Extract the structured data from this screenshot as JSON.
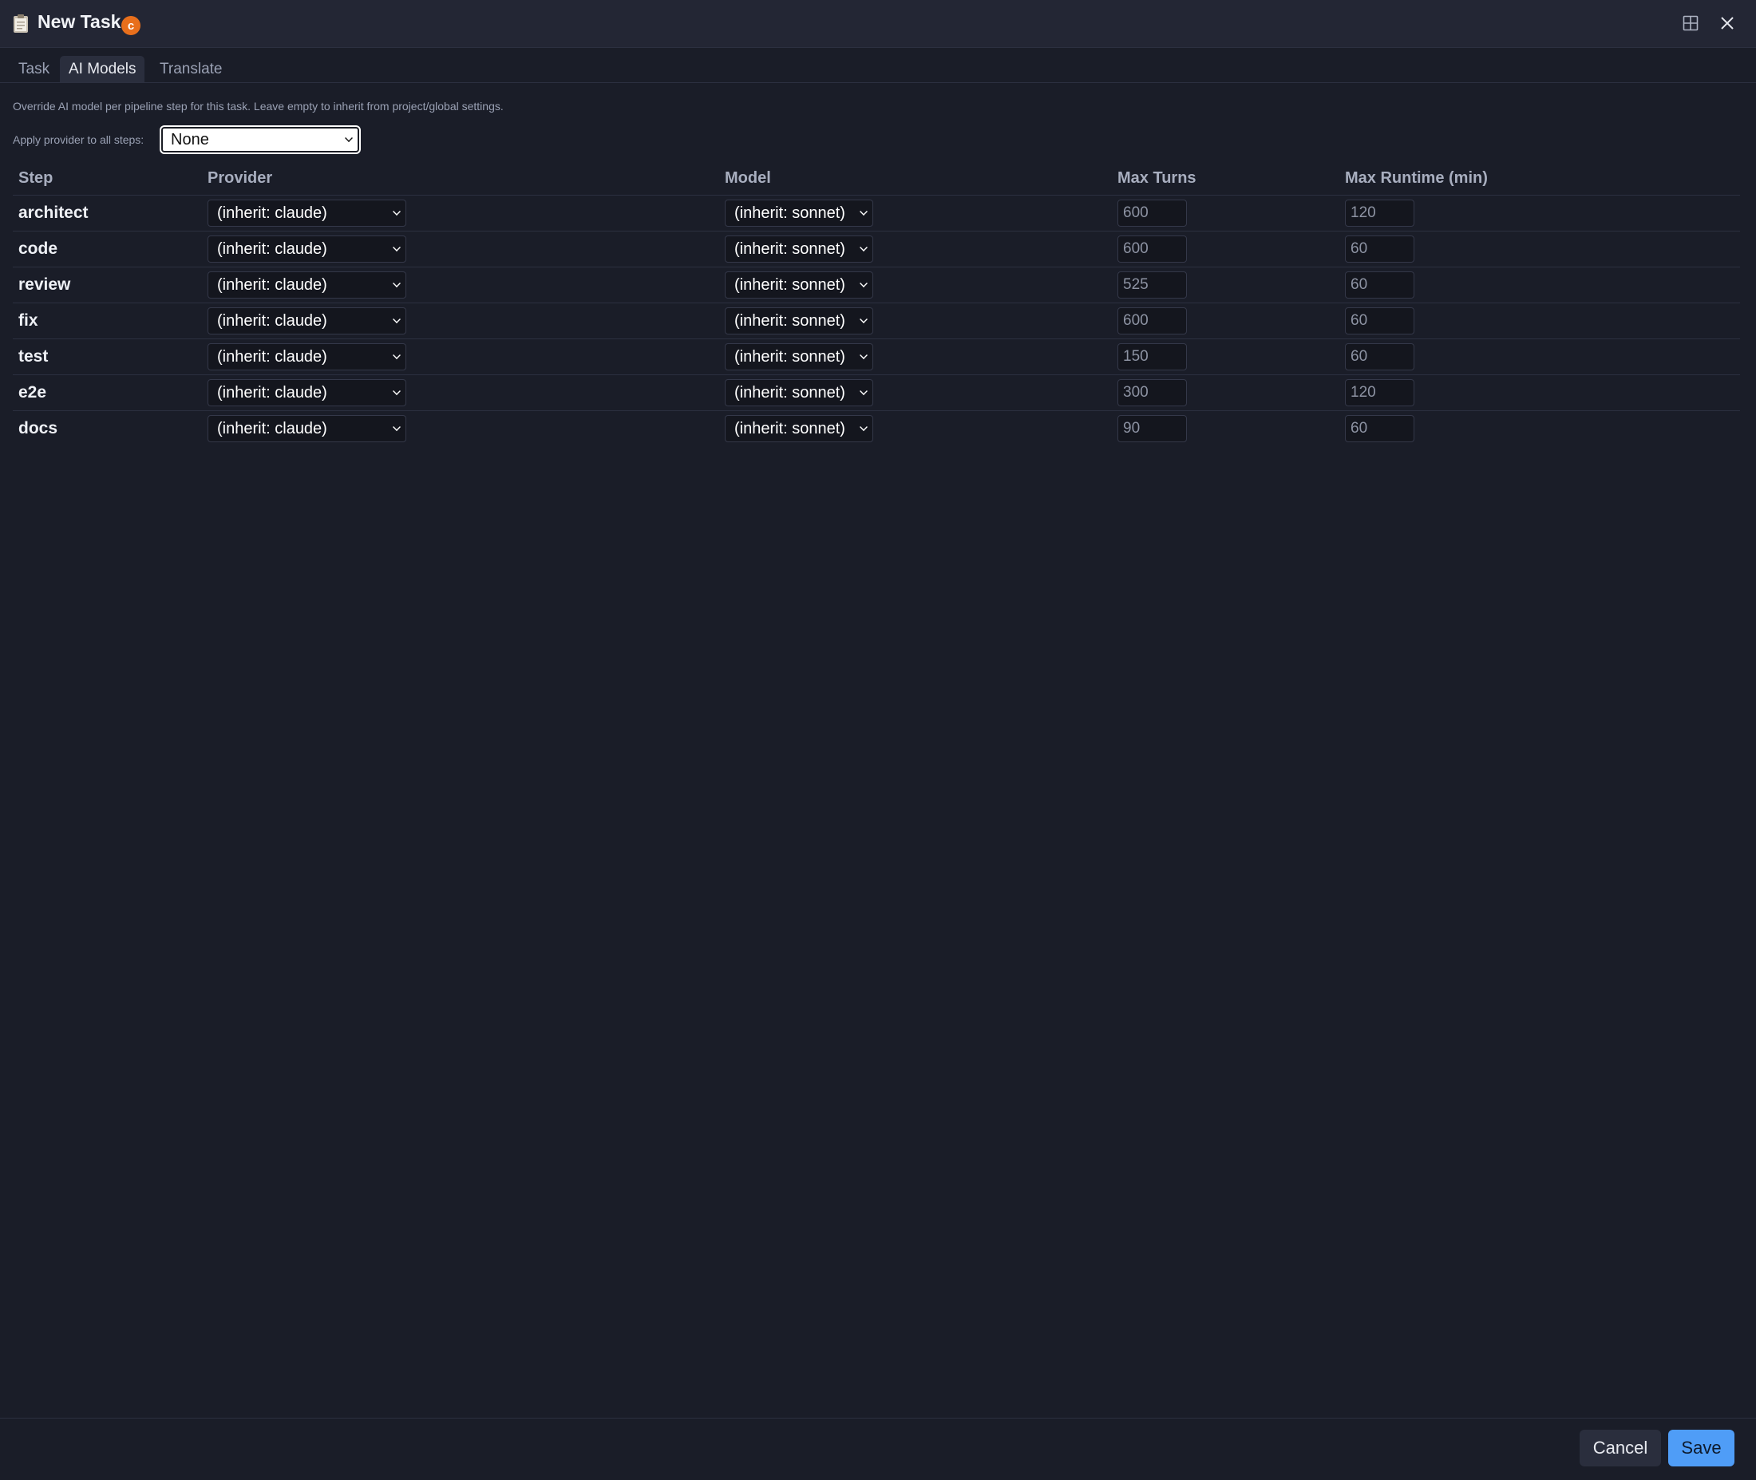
{
  "window": {
    "title": "New Task",
    "badge": "c",
    "icons": {
      "title": "clipboard-icon",
      "layout": "layout-grid-icon",
      "close": "close-icon"
    }
  },
  "tabs": [
    {
      "label": "Task",
      "active": false
    },
    {
      "label": "AI Models",
      "active": true
    },
    {
      "label": "Translate",
      "active": false
    }
  ],
  "hint": "Override AI model per pipeline step for this task. Leave empty to inherit from project/global settings.",
  "apply": {
    "label": "Apply provider to all steps:",
    "value": "None"
  },
  "table": {
    "headers": [
      "Step",
      "Provider",
      "Model",
      "Max Turns",
      "Max Runtime (min)"
    ],
    "rows": [
      {
        "step": "architect",
        "provider": "(inherit: claude)",
        "model": "(inherit: sonnet)",
        "max_turns": "600",
        "max_runtime": "120"
      },
      {
        "step": "code",
        "provider": "(inherit: claude)",
        "model": "(inherit: sonnet)",
        "max_turns": "600",
        "max_runtime": "60"
      },
      {
        "step": "review",
        "provider": "(inherit: claude)",
        "model": "(inherit: sonnet)",
        "max_turns": "525",
        "max_runtime": "60"
      },
      {
        "step": "fix",
        "provider": "(inherit: claude)",
        "model": "(inherit: sonnet)",
        "max_turns": "600",
        "max_runtime": "60"
      },
      {
        "step": "test",
        "provider": "(inherit: claude)",
        "model": "(inherit: sonnet)",
        "max_turns": "150",
        "max_runtime": "60"
      },
      {
        "step": "e2e",
        "provider": "(inherit: claude)",
        "model": "(inherit: sonnet)",
        "max_turns": "300",
        "max_runtime": "120"
      },
      {
        "step": "docs",
        "provider": "(inherit: claude)",
        "model": "(inherit: sonnet)",
        "max_turns": "90",
        "max_runtime": "60"
      }
    ]
  },
  "footer": {
    "cancel_label": "Cancel",
    "save_label": "Save"
  },
  "colors": {
    "background": "#1a1d28",
    "accent": "#4f9df7",
    "badge": "#e86f1c"
  }
}
